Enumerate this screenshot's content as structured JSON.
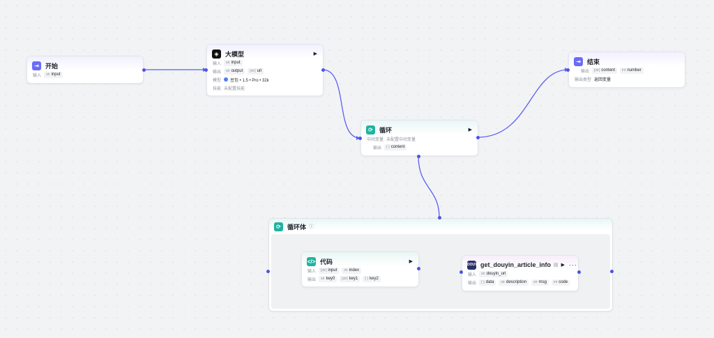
{
  "start": {
    "title": "开始",
    "input_label": "输入",
    "input_type": "str",
    "input_var": "input"
  },
  "llm": {
    "title": "大模型",
    "input_label": "输入",
    "input_type": "str",
    "input_var": "input",
    "output_label": "输出",
    "out1_type": "str",
    "out1": "output",
    "out2_type": "[str]",
    "out2": "url",
    "model_label": "模型",
    "model_value": "豆包 • 1.5 • Pro • 32k",
    "skill_label": "技能",
    "skill_value": "未配置技能"
  },
  "loop": {
    "title": "循环",
    "midvar_label": "中间变量",
    "midvar_value": "未配置中间变量",
    "output_label": "输出",
    "out_type": "{ }",
    "out_var": "content"
  },
  "end": {
    "title": "结束",
    "output_label": "输出",
    "out1_type": "[str]",
    "out1": "content",
    "out2_type": "int",
    "out2": "number",
    "mode_label": "输出类型",
    "mode_value": "返回变量"
  },
  "loop_body": {
    "title": "循环体"
  },
  "code": {
    "title": "代码",
    "input_label": "输入",
    "in1_type": "[str]",
    "in1": "input",
    "in2_type": "int",
    "in2": "index",
    "output_label": "输出",
    "out1_type": "str",
    "out1": "key0",
    "out2_type": "[str]",
    "out2": "key1",
    "out3_type": "{ }",
    "out3": "key2"
  },
  "plugin": {
    "title": "get_douyin_article_info",
    "icon_text": "DOUYIN",
    "input_label": "输入",
    "in1_type": "str",
    "in1": "douyin_url",
    "output_label": "输出",
    "out1_type": "{ }",
    "out1": "data",
    "out2_type": "str",
    "out2": "description",
    "out3_type": "str",
    "out3": "msg",
    "out4_type": "int",
    "out4": "code"
  },
  "colors": {
    "accent": "#4d53e8",
    "canvas": "#f2f3f5"
  }
}
